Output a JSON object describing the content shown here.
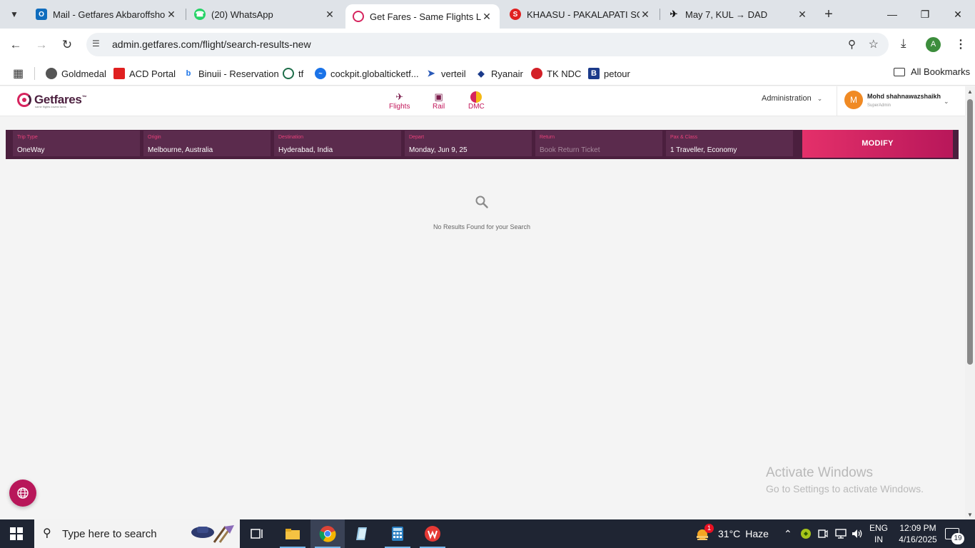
{
  "browser": {
    "tabs": [
      {
        "title": "Mail - Getfares Akbaroffshore",
        "favicon": "outlook-icon"
      },
      {
        "title": "(20) WhatsApp",
        "favicon": "whatsapp-icon"
      },
      {
        "title": "Get Fares - Same Flights Low",
        "favicon": "getfares-icon",
        "active": true
      },
      {
        "title": "KHAASU - PAKALAPATI SOLO",
        "favicon": "s-icon"
      },
      {
        "title": "May 7, KUL → DAD",
        "favicon": "plane-icon"
      }
    ],
    "url": "admin.getfares.com/flight/search-results-new",
    "profile_initial": "A",
    "bookmarks": [
      {
        "label": "Goldmedal"
      },
      {
        "label": "ACD Portal"
      },
      {
        "label": "Binuii - Reservation"
      },
      {
        "label": "tf"
      },
      {
        "label": "cockpit.globalticketf..."
      },
      {
        "label": "verteil"
      },
      {
        "label": "Ryanair"
      },
      {
        "label": "TK NDC"
      },
      {
        "label": "petour"
      }
    ],
    "all_bookmarks": "All Bookmarks"
  },
  "site": {
    "logo_text": "Getfares",
    "logo_tm": "™",
    "logo_tagline": "same flights lowest fares",
    "nav": [
      {
        "label": "Flights",
        "icon": "plane-icon"
      },
      {
        "label": "Rail",
        "icon": "train-icon"
      },
      {
        "label": "DMC",
        "icon": "dmc-icon"
      }
    ],
    "admin_label": "Administration",
    "user": {
      "initial": "M",
      "name": "Mohd shahnawazshaikh",
      "role": "SuperAdmin"
    }
  },
  "search": {
    "fields": [
      {
        "label": "Trip Type",
        "value": "OneWay"
      },
      {
        "label": "Origin",
        "value": "Melbourne, Australia"
      },
      {
        "label": "Destination",
        "value": "Hyderabad, India"
      },
      {
        "label": "Depart",
        "value": "Monday, Jun 9, 25"
      },
      {
        "label": "Return",
        "value": "Book Return Ticket"
      },
      {
        "label": "Pax & Class",
        "value": "1 Traveller, Economy"
      }
    ],
    "modify_label": "MODIFY"
  },
  "results": {
    "empty_message": "No Results Found for your Search"
  },
  "watermark": {
    "line1": "Activate Windows",
    "line2": "Go to Settings to activate Windows."
  },
  "taskbar": {
    "search_placeholder": "Type here to search",
    "weather": {
      "badge": "1",
      "temp": "31°C",
      "condition": "Haze"
    },
    "lang": {
      "line1": "ENG",
      "line2": "IN"
    },
    "clock": {
      "time": "12:09 PM",
      "date": "4/16/2025"
    },
    "notification_count": "19"
  },
  "colors": {
    "brand_dark": "#4b1f3e",
    "brand_accent": "#e4306a"
  }
}
